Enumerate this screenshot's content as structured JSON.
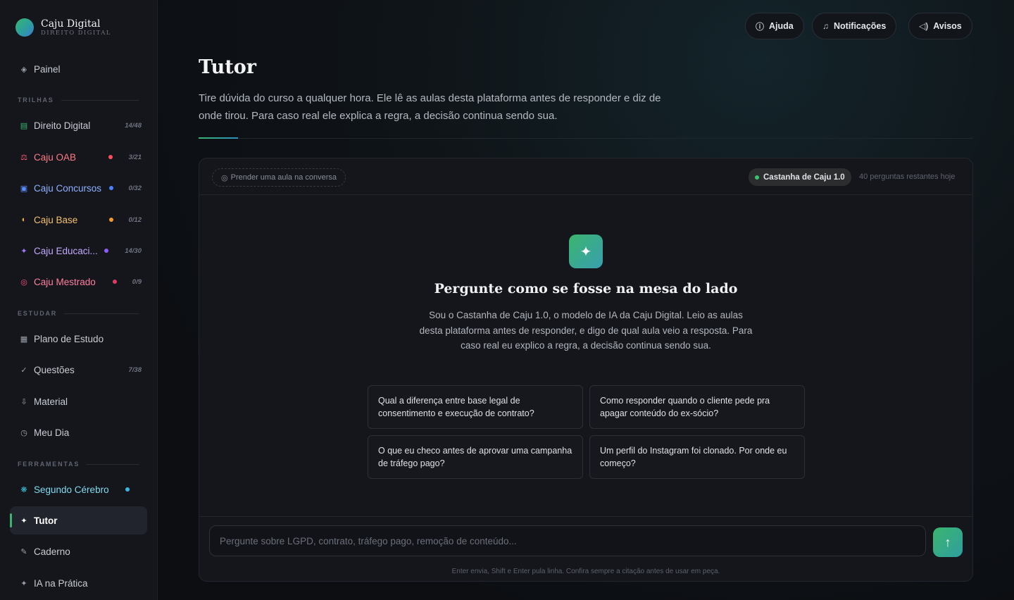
{
  "brand": {
    "name": "Caju Digital",
    "subtitle": "DIREITO DIGITAL"
  },
  "sidebar": {
    "painel": {
      "label": "Painel",
      "icon": "diamond-icon"
    },
    "sections": {
      "trilhas": "TRILHAS",
      "estudar": "ESTUDAR",
      "ferramentas": "FERRAMENTAS"
    },
    "trilhas": [
      {
        "label": "Direito Digital",
        "count": "14/48",
        "icon": "list-icon",
        "color": "#3bb56e"
      },
      {
        "label": "Caju OAB",
        "count": "3/21",
        "icon": "scales-icon",
        "color": "#ff5c6c",
        "dot": "#ff4d5e"
      },
      {
        "label": "Caju Concursos",
        "count": "0/32",
        "icon": "square-icon",
        "color": "#5a8dff",
        "dot": "#4a7fff"
      },
      {
        "label": "Caju Base",
        "count": "0/12",
        "icon": "half-circle-icon",
        "color": "#f2a93b",
        "dot": "#f29b2b"
      },
      {
        "label": "Caju Educaci...",
        "count": "14/30",
        "icon": "sparkle-icon",
        "color": "#a27bff",
        "dot": "#8d5cff"
      },
      {
        "label": "Caju Mestrado",
        "count": "0/9",
        "icon": "target-icon",
        "color": "#ff4f7b",
        "dot": "#e23a62"
      }
    ],
    "estudar": [
      {
        "label": "Plano de Estudo",
        "count": "",
        "icon": "grid-icon"
      },
      {
        "label": "Questões",
        "count": "7/38",
        "icon": "check-icon"
      },
      {
        "label": "Material",
        "count": "",
        "icon": "pin-icon"
      },
      {
        "label": "Meu Dia",
        "count": "",
        "icon": "clock-icon"
      }
    ],
    "ferramentas": [
      {
        "label": "Segundo Cérebro",
        "icon": "snowflake-icon",
        "color": "#38c6e0",
        "dot": "#38b7e0"
      },
      {
        "label": "Tutor",
        "icon": "sparkle-icon",
        "active": true
      },
      {
        "label": "Caderno",
        "icon": "pencil-icon"
      },
      {
        "label": "IA na Prática",
        "icon": "sparkle-icon"
      }
    ]
  },
  "topbar": {
    "help": "Ajuda",
    "notifications": "Notificações",
    "notices": "Avisos"
  },
  "page": {
    "title": "Tutor",
    "description": "Tire dúvida do curso a qualquer hora. Ele lê as aulas desta plataforma antes de responder e diz de onde tirou. Para caso real ele explica a regra, a decisão continua sendo sua."
  },
  "chat": {
    "attach_label": "Prender uma aula na conversa",
    "model": "Castanha de Caju 1.0",
    "remaining": "40 perguntas restantes hoje",
    "hero_title": "Pergunte como se fosse na mesa do lado",
    "hero_text": "Sou o Castanha de Caju 1.0, o modelo de IA da Caju Digital. Leio as aulas desta plataforma antes de responder, e digo de qual aula veio a resposta. Para caso real eu explico a regra, a decisão continua sendo sua.",
    "suggestions": [
      "Qual a diferença entre base legal de consentimento e execução de contrato?",
      "Como responder quando o cliente pede pra apagar conteúdo do ex-sócio?",
      "O que eu checo antes de aprovar uma campanha de tráfego pago?",
      "Um perfil do Instagram foi clonado. Por onde eu começo?"
    ],
    "input_placeholder": "Pergunte sobre LGPD, contrato, tráfego pago, remoção de conteúdo...",
    "input_value": "",
    "hint": "Enter envia, Shift e Enter pula linha. Confira sempre a citação antes de usar em peça."
  },
  "colors": {
    "accent": "#3bb56e",
    "accent2": "#2f9ea0",
    "sidebar_bg": "#14161c",
    "bg": "#0c0e12"
  }
}
